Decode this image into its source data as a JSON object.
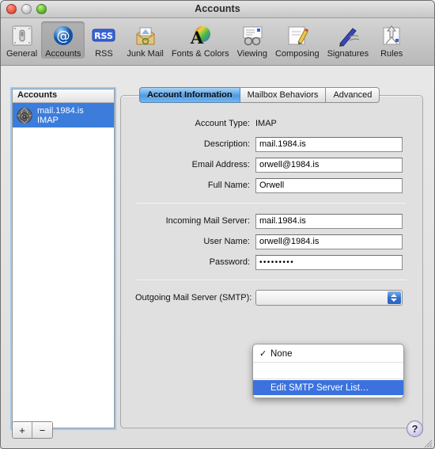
{
  "window": {
    "title": "Accounts"
  },
  "traffic_lights": [
    {
      "name": "close",
      "label": "close"
    },
    {
      "name": "minimize",
      "label": "minimize"
    },
    {
      "name": "zoom",
      "label": "zoom"
    }
  ],
  "toolbar": {
    "items": [
      {
        "label": "General",
        "icon": "general-icon",
        "selected": false
      },
      {
        "label": "Accounts",
        "icon": "accounts-at-icon",
        "selected": true
      },
      {
        "label": "RSS",
        "icon": "rss-icon",
        "selected": false
      },
      {
        "label": "Junk Mail",
        "icon": "junk-mail-icon",
        "selected": false
      },
      {
        "label": "Fonts & Colors",
        "icon": "fonts-colors-icon",
        "selected": false
      },
      {
        "label": "Viewing",
        "icon": "viewing-icon",
        "selected": false
      },
      {
        "label": "Composing",
        "icon": "composing-icon",
        "selected": false
      },
      {
        "label": "Signatures",
        "icon": "signatures-icon",
        "selected": false
      },
      {
        "label": "Rules",
        "icon": "rules-icon",
        "selected": false
      }
    ]
  },
  "sidebar": {
    "header": "Accounts",
    "accounts": [
      {
        "name": "mail.1984.is",
        "type": "IMAP",
        "selected": true
      }
    ],
    "add_button": "+",
    "remove_button": "−"
  },
  "tabs": [
    {
      "label": "Account Information",
      "selected": true
    },
    {
      "label": "Mailbox Behaviors",
      "selected": false
    },
    {
      "label": "Advanced",
      "selected": false
    }
  ],
  "form": {
    "account_type": {
      "label": "Account Type:",
      "value": "IMAP"
    },
    "description": {
      "label": "Description:",
      "value": "mail.1984.is"
    },
    "email": {
      "label": "Email Address:",
      "value": "orwell@1984.is"
    },
    "full_name": {
      "label": "Full Name:",
      "value": "Orwell"
    },
    "incoming": {
      "label": "Incoming Mail Server:",
      "value": "mail.1984.is"
    },
    "user_name": {
      "label": "User Name:",
      "value": "orwell@1984.is"
    },
    "password": {
      "label": "Password:",
      "value": "•••••••••"
    },
    "outgoing": {
      "label": "Outgoing Mail Server (SMTP):",
      "value": "None"
    }
  },
  "smtp_menu": {
    "open": true,
    "items": [
      {
        "label": "None",
        "checked": true,
        "highlighted": false,
        "enabled": true
      },
      {
        "label": "",
        "checked": false,
        "highlighted": false,
        "enabled": false
      },
      {
        "label": "Edit SMTP Server List…",
        "checked": false,
        "highlighted": true,
        "enabled": true
      }
    ],
    "highlight_color": "#3b72de"
  },
  "help": {
    "label": "?"
  },
  "colors": {
    "selection_blue": "#3c7ddc",
    "menu_highlight": "#3b72de",
    "tab_selected": "#4e9ae4",
    "window_bg": "#e0e0e0"
  }
}
